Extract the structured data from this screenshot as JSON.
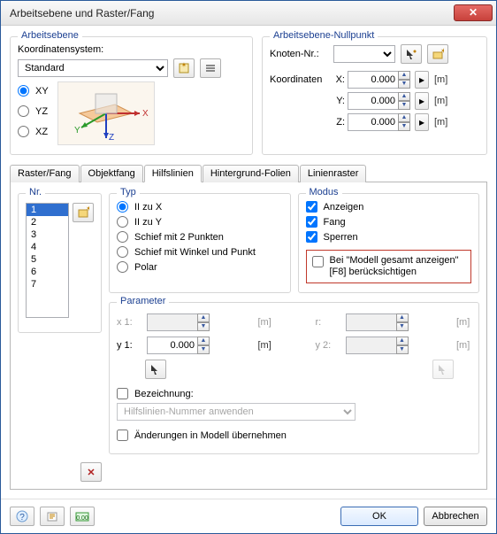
{
  "window": {
    "title": "Arbeitsebene und Raster/Fang"
  },
  "arbeitsebene": {
    "legend": "Arbeitsebene",
    "koord_label": "Koordinatensystem:",
    "koord_value": "Standard",
    "planes": {
      "xy": "XY",
      "yz": "YZ",
      "xz": "XZ"
    }
  },
  "nullpunkt": {
    "legend": "Arbeitsebene-Nullpunkt",
    "knoten_label": "Knoten-Nr.:",
    "knoten_value": "",
    "koord_label": "Koordinaten",
    "x": {
      "label": "X:",
      "value": "0.000",
      "unit": "[m]"
    },
    "y": {
      "label": "Y:",
      "value": "0.000",
      "unit": "[m]"
    },
    "z": {
      "label": "Z:",
      "value": "0.000",
      "unit": "[m]"
    }
  },
  "tabs": {
    "rasterfang": "Raster/Fang",
    "objektfang": "Objektfang",
    "hilfslinien": "Hilfslinien",
    "hintergrund": "Hintergrund-Folien",
    "linienraster": "Linienraster"
  },
  "nr": {
    "legend": "Nr.",
    "items": [
      "1",
      "2",
      "3",
      "4",
      "5",
      "6",
      "7"
    ]
  },
  "typ": {
    "legend": "Typ",
    "ii_x": "II zu X",
    "ii_y": "II zu Y",
    "schief2": "Schief mit 2 Punkten",
    "schiefwp": "Schief mit Winkel und Punkt",
    "polar": "Polar"
  },
  "modus": {
    "legend": "Modus",
    "anzeigen": "Anzeigen",
    "fang": "Fang",
    "sperren": "Sperren",
    "f8": "Bei \"Modell gesamt anzeigen\" [F8] berücksichtigen"
  },
  "parameter": {
    "legend": "Parameter",
    "x1": "x 1:",
    "y1": "y 1:",
    "r": "r:",
    "y2": "y 2:",
    "y1_value": "0.000",
    "unit": "[m]",
    "bezeichnung_label": "Bezeichnung:",
    "bezeichnung_value": "Hilfslinien-Nummer anwenden",
    "apply_changes": "Änderungen in Modell übernehmen"
  },
  "footer": {
    "ok": "OK",
    "cancel": "Abbrechen"
  }
}
